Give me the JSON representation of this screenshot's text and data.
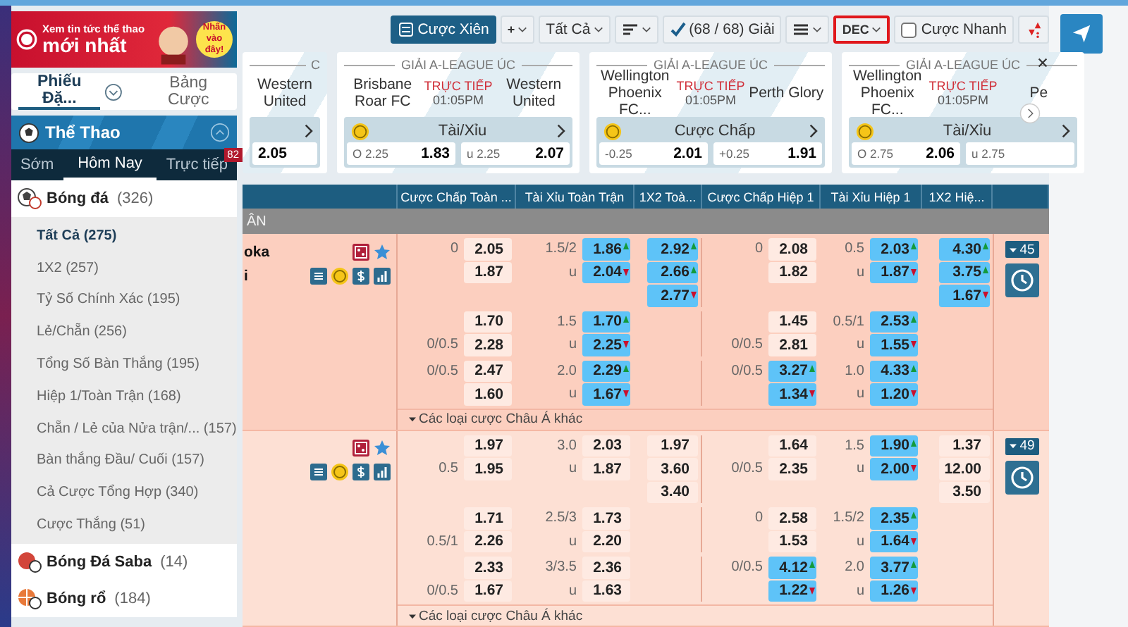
{
  "banner": {
    "line1": "Xem tin tức thể thao",
    "line2": "mới nhất",
    "badge": "Nhấn vào đây!"
  },
  "sidebar_tabs": [
    {
      "label": "Phiếu Đặ...",
      "selected": true
    },
    {
      "label": "Bảng Cược",
      "selected": false
    }
  ],
  "sports_panel": {
    "title": "Thể Thao",
    "expanded": true,
    "tabs": [
      {
        "label": "Sớm",
        "selected": false
      },
      {
        "label": "Hôm Nay",
        "selected": true
      },
      {
        "label": "Trực tiếp",
        "selected": false,
        "badge": "82"
      }
    ]
  },
  "sports": [
    {
      "kind": "soccer",
      "name": "Bóng đá",
      "count": "(326)",
      "expanded": true,
      "children": [
        {
          "label": "Tất Cả",
          "count": "(275)",
          "selected": true
        },
        {
          "label": "1X2",
          "count": "(257)",
          "selected": false
        },
        {
          "label": "Tỷ Số Chính Xác",
          "count": "(195)",
          "selected": false
        },
        {
          "label": "Lẻ/Chẵn",
          "count": "(256)",
          "selected": false
        },
        {
          "label": "Tổng Số Bàn Thắng",
          "count": "(195)",
          "selected": false
        },
        {
          "label": "Hiệp 1/Toàn Trận",
          "count": "(168)",
          "selected": false
        },
        {
          "label": "Chẵn / Lẻ của Nửa trận/...",
          "count": "(157)",
          "selected": false
        },
        {
          "label": "Bàn thắng Đầu/ Cuối",
          "count": "(157)",
          "selected": false
        },
        {
          "label": "Cả Cược Tổng Hợp",
          "count": "(340)",
          "selected": false
        },
        {
          "label": "Cược Thắng",
          "count": "(51)",
          "selected": false
        }
      ]
    },
    {
      "kind": "virtual",
      "name": "Bóng Đá Saba",
      "count": "(14)",
      "expanded": false
    },
    {
      "kind": "basketball",
      "name": "Bóng rổ",
      "count": "(184)",
      "expanded": false
    }
  ],
  "toolbar": [
    {
      "kind": "primary",
      "label": "Cược Xiên",
      "highlighted": false
    },
    {
      "kind": "dropdown",
      "label": "+",
      "highlighted": false
    },
    {
      "kind": "dropdown",
      "label": "Tất Cả",
      "highlighted": false
    },
    {
      "kind": "sort",
      "highlighted": false
    },
    {
      "kind": "filter",
      "label": "(68 / 68) Giải",
      "highlighted": false
    },
    {
      "kind": "list",
      "highlighted": false
    },
    {
      "kind": "dropdown",
      "label": "DEC",
      "highlighted": true
    },
    {
      "kind": "checkbox",
      "label": "Cược Nhanh",
      "checked": false,
      "highlighted": false
    },
    {
      "kind": "arrows",
      "highlighted": false
    }
  ],
  "match_cards": [
    {
      "league": "C",
      "away": "Western United",
      "odds": [
        {
          "value": "2.05"
        }
      ]
    },
    {
      "league": "GIẢI A-LEAGUE ÚC",
      "home": "Brisbane Roar FC",
      "status": "TRỰC TIẾP",
      "time": "01:05PM",
      "away": "Western United",
      "market": "Tài/Xỉu",
      "odds": [
        {
          "label": "O 2.25",
          "value": "1.83"
        },
        {
          "label": "u 2.25",
          "value": "2.07"
        }
      ]
    },
    {
      "league": "GIẢI A-LEAGUE ÚC",
      "home": "Wellington Phoenix FC...",
      "status": "TRỰC TIẾP",
      "time": "01:05PM",
      "away": "Perth Glory",
      "market": "Cược Chấp",
      "odds": [
        {
          "label": "-0.25",
          "value": "2.01"
        },
        {
          "label": "+0.25",
          "value": "1.91"
        }
      ]
    },
    {
      "league": "GIẢI A-LEAGUE ÚC",
      "home": "Wellington Phoenix FC...",
      "status": "TRỰC TIẾP",
      "time": "01:05PM",
      "away": "Pe",
      "market": "Tài/Xỉu",
      "odds": [
        {
          "label": "O 2.75",
          "value": "2.06"
        },
        {
          "label": "u 2.75"
        }
      ]
    }
  ],
  "table": {
    "columns": [
      "Cược Chấp Toàn ...",
      "Tài Xỉu Toàn Trận",
      "1X2 Toà...",
      "Cược Chấp Hiệp 1",
      "Tài Xỉu Hiệp 1",
      "1X2 Hiệ..."
    ],
    "section": "ÂN",
    "matches": [
      {
        "home": "oka",
        "away": "i",
        "more": "45",
        "footer": "Các loại cược Châu Á khác",
        "lines": [
          {
            "hdp_ft": [
              {
                "label": "0",
                "value": "2.05",
                "up": false,
                "down": false
              },
              {
                "value": "1.87",
                "up": false,
                "down": false
              }
            ],
            "ou_ft": [
              {
                "label": "1.5/2",
                "value": "1.86",
                "up": true,
                "down": false
              },
              {
                "label": "u",
                "value": "2.04",
                "up": false,
                "down": true
              }
            ],
            "x12_ft": [
              {
                "value": "2.92",
                "up": true,
                "down": false
              },
              {
                "value": "2.66",
                "up": true,
                "down": false
              },
              {
                "value": "2.77",
                "up": false,
                "down": true
              }
            ],
            "hdp_h1": [
              {
                "label": "0",
                "value": "2.08",
                "up": false,
                "down": false
              },
              {
                "value": "1.82",
                "up": false,
                "down": false
              }
            ],
            "ou_h1": [
              {
                "label": "0.5",
                "value": "2.03",
                "up": true,
                "down": false
              },
              {
                "label": "u",
                "value": "1.87",
                "up": false,
                "down": true
              }
            ],
            "x12_h1": [
              {
                "value": "4.30",
                "up": true,
                "down": false
              },
              {
                "value": "3.75",
                "up": true,
                "down": false
              },
              {
                "value": "1.67",
                "up": false,
                "down": true
              }
            ]
          },
          {
            "hdp_ft": [
              {
                "value": "1.70",
                "up": false,
                "down": false
              },
              {
                "label": "0/0.5",
                "value": "2.28",
                "up": false,
                "down": false
              }
            ],
            "ou_ft": [
              {
                "label": "1.5",
                "value": "1.70",
                "up": true,
                "down": false
              },
              {
                "label": "u",
                "value": "2.25",
                "up": false,
                "down": true
              }
            ],
            "hdp_h1": [
              {
                "value": "1.45",
                "up": false,
                "down": false
              },
              {
                "label": "0/0.5",
                "value": "2.81",
                "up": false,
                "down": false
              }
            ],
            "ou_h1": [
              {
                "label": "0.5/1",
                "value": "2.53",
                "up": true,
                "down": false
              },
              {
                "label": "u",
                "value": "1.55",
                "up": false,
                "down": true
              }
            ]
          },
          {
            "hdp_ft": [
              {
                "label": "0/0.5",
                "value": "2.47",
                "up": false,
                "down": false
              },
              {
                "value": "1.60",
                "up": false,
                "down": false
              }
            ],
            "ou_ft": [
              {
                "label": "2.0",
                "value": "2.29",
                "up": true,
                "down": false
              },
              {
                "label": "u",
                "value": "1.67",
                "up": false,
                "down": true
              }
            ],
            "hdp_h1": [
              {
                "label": "0/0.5",
                "value": "3.27",
                "up": true,
                "down": false
              },
              {
                "value": "1.34",
                "up": false,
                "down": true
              }
            ],
            "ou_h1": [
              {
                "label": "1.0",
                "value": "4.33",
                "up": true,
                "down": false
              },
              {
                "label": "u",
                "value": "1.20",
                "up": false,
                "down": true
              }
            ]
          }
        ]
      },
      {
        "more": "49",
        "footer": "Các loại cược Châu Á khác",
        "lines": [
          {
            "hdp_ft": [
              {
                "value": "1.97",
                "up": false,
                "down": false
              },
              {
                "label": "0.5",
                "value": "1.95",
                "up": false,
                "down": false
              }
            ],
            "ou_ft": [
              {
                "label": "3.0",
                "value": "2.03",
                "up": false,
                "down": false
              },
              {
                "label": "u",
                "value": "1.87",
                "up": false,
                "down": false
              }
            ],
            "x12_ft": [
              {
                "value": "1.97",
                "up": false,
                "down": false
              },
              {
                "value": "3.60",
                "up": false,
                "down": false
              },
              {
                "value": "3.40",
                "up": false,
                "down": false
              }
            ],
            "hdp_h1": [
              {
                "value": "1.64",
                "up": false,
                "down": false
              },
              {
                "label": "0/0.5",
                "value": "2.35",
                "up": false,
                "down": false
              }
            ],
            "ou_h1": [
              {
                "label": "1.5",
                "value": "1.90",
                "up": true,
                "down": false
              },
              {
                "label": "u",
                "value": "2.00",
                "up": false,
                "down": true
              }
            ],
            "x12_h1": [
              {
                "value": "1.37",
                "up": false,
                "down": false
              },
              {
                "value": "12.00",
                "up": false,
                "down": false
              },
              {
                "value": "3.50",
                "up": false,
                "down": false
              }
            ]
          },
          {
            "hdp_ft": [
              {
                "value": "1.71",
                "up": false,
                "down": false
              },
              {
                "label": "0.5/1",
                "value": "2.26",
                "up": false,
                "down": false
              }
            ],
            "ou_ft": [
              {
                "label": "2.5/3",
                "value": "1.73",
                "up": false,
                "down": false
              },
              {
                "label": "u",
                "value": "2.20",
                "up": false,
                "down": false
              }
            ],
            "hdp_h1": [
              {
                "label": "0",
                "value": "2.58",
                "up": false,
                "down": false
              },
              {
                "value": "1.53",
                "up": false,
                "down": false
              }
            ],
            "ou_h1": [
              {
                "label": "1.5/2",
                "value": "2.35",
                "up": true,
                "down": false
              },
              {
                "label": "u",
                "value": "1.64",
                "up": false,
                "down": true
              }
            ]
          },
          {
            "hdp_ft": [
              {
                "value": "2.33",
                "up": false,
                "down": false
              },
              {
                "label": "0/0.5",
                "value": "1.67",
                "up": false,
                "down": false
              }
            ],
            "ou_ft": [
              {
                "label": "3/3.5",
                "value": "2.36",
                "up": false,
                "down": false
              },
              {
                "label": "u",
                "value": "1.63",
                "up": false,
                "down": false
              }
            ],
            "hdp_h1": [
              {
                "label": "0/0.5",
                "value": "4.12",
                "up": true,
                "down": false
              },
              {
                "value": "1.22",
                "up": false,
                "down": true
              }
            ],
            "ou_h1": [
              {
                "label": "2.0",
                "value": "3.77",
                "up": true,
                "down": false
              },
              {
                "label": "u",
                "value": "1.26",
                "up": false,
                "down": true
              }
            ]
          }
        ]
      }
    ]
  }
}
